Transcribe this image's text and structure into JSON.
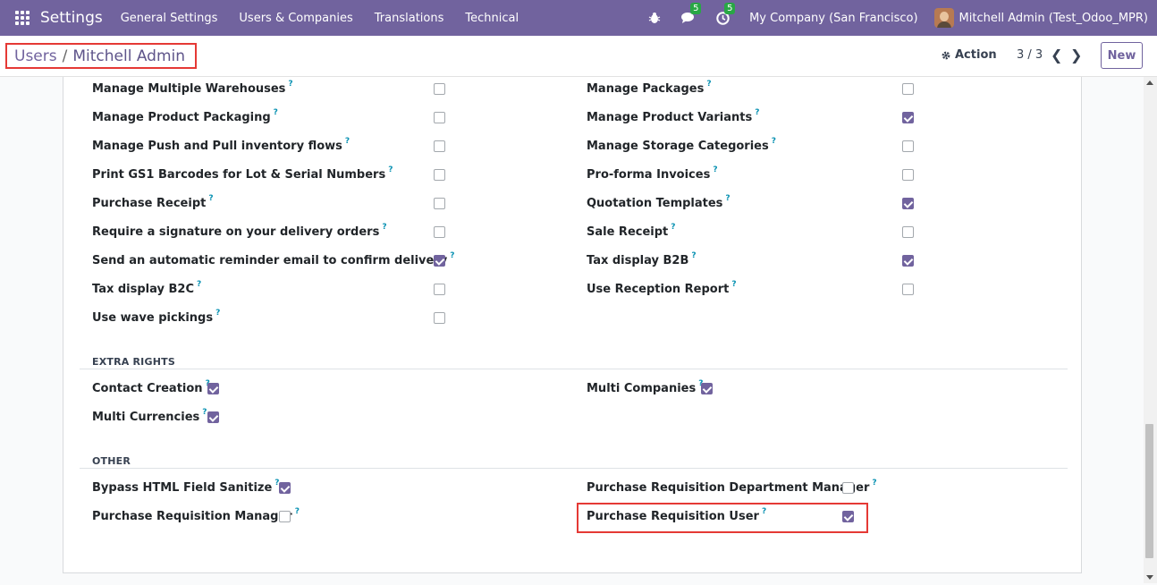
{
  "navbar": {
    "brand": "Settings",
    "menu": [
      "General Settings",
      "Users & Companies",
      "Translations",
      "Technical"
    ],
    "chat_count": "5",
    "activity_count": "5",
    "company": "My Company (San Francisco)",
    "user": "Mitchell Admin (Test_Odoo_MPR)"
  },
  "breadcrumb": {
    "parent": "Users",
    "separator": "/",
    "current": "Mitchell Admin"
  },
  "control": {
    "action_label": "Action",
    "pager": "3 / 3",
    "new_label": "New"
  },
  "settings_left": [
    {
      "label": "Manage Multiple Warehouses",
      "checked": false
    },
    {
      "label": "Manage Product Packaging",
      "checked": false
    },
    {
      "label": "Manage Push and Pull inventory flows",
      "checked": false
    },
    {
      "label": "Print GS1 Barcodes for Lot & Serial Numbers",
      "checked": false
    },
    {
      "label": "Purchase Receipt",
      "checked": false
    },
    {
      "label": "Require a signature on your delivery orders",
      "checked": false
    },
    {
      "label": "Send an automatic reminder email to confirm delivery",
      "checked": true
    },
    {
      "label": "Tax display B2C",
      "checked": false
    },
    {
      "label": "Use wave pickings",
      "checked": false
    }
  ],
  "settings_right": [
    {
      "label": "Manage Packages",
      "checked": false
    },
    {
      "label": "Manage Product Variants",
      "checked": true
    },
    {
      "label": "Manage Storage Categories",
      "checked": false
    },
    {
      "label": "Pro-forma Invoices",
      "checked": false
    },
    {
      "label": "Quotation Templates",
      "checked": true
    },
    {
      "label": "Sale Receipt",
      "checked": false
    },
    {
      "label": "Tax display B2B",
      "checked": true
    },
    {
      "label": "Use Reception Report",
      "checked": false
    }
  ],
  "extra_rights": {
    "title": "EXTRA RIGHTS",
    "items": [
      {
        "label": "Contact Creation",
        "checked": true
      },
      {
        "label": "Multi Companies",
        "checked": true
      },
      {
        "label": "Multi Currencies",
        "checked": true
      }
    ]
  },
  "other": {
    "title": "OTHER",
    "items": [
      {
        "label": "Bypass HTML Field Sanitize",
        "checked": true
      },
      {
        "label": "Purchase Requisition Department Manager",
        "checked": false
      },
      {
        "label": "Purchase Requisition Manager",
        "checked": false
      },
      {
        "label": "Purchase Requisition User",
        "checked": true
      }
    ]
  },
  "help_mark": "?"
}
